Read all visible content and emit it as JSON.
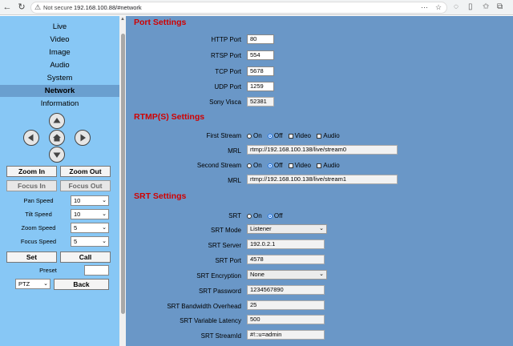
{
  "browser": {
    "security_label": "Not secure",
    "url": "192.168.100.88/#network"
  },
  "sidebar": {
    "menu": [
      "Live",
      "Video",
      "Image",
      "Audio",
      "System",
      "Network",
      "Information"
    ],
    "active_menu": "Network",
    "zoom_in": "Zoom In",
    "zoom_out": "Zoom Out",
    "focus_in": "Focus In",
    "focus_out": "Focus Out",
    "pan_speed_label": "Pan Speed",
    "pan_speed": "10",
    "tilt_speed_label": "Tilt Speed",
    "tilt_speed": "10",
    "zoom_speed_label": "Zoom Speed",
    "zoom_speed": "5",
    "focus_speed_label": "Focus Speed",
    "focus_speed": "5",
    "set": "Set",
    "call": "Call",
    "preset_label": "Preset",
    "preset_value": "",
    "mode": "PTZ",
    "back": "Back"
  },
  "port_settings": {
    "title": "Port Settings",
    "http_label": "HTTP Port",
    "http": "80",
    "rtsp_label": "RTSP Port",
    "rtsp": "554",
    "tcp_label": "TCP Port",
    "tcp": "5678",
    "udp_label": "UDP Port",
    "udp": "1259",
    "visca_label": "Sony Visca",
    "visca": "52381"
  },
  "rtmp": {
    "title": "RTMP(S) Settings",
    "first_label": "First Stream",
    "second_label": "Second Stream",
    "on": "On",
    "off": "Off",
    "video": "Video",
    "audio": "Audio",
    "mrl_label": "MRL",
    "mrl1": "rtmp://192.168.100.138/live/stream0",
    "mrl2": "rtmp://192.168.100.138/live/stream1"
  },
  "srt": {
    "title": "SRT Settings",
    "srt_label": "SRT",
    "on": "On",
    "off": "Off",
    "mode_label": "SRT Mode",
    "mode": "Listener",
    "server_label": "SRT Server",
    "server": "192.0.2.1",
    "port_label": "SRT Port",
    "port": "4578",
    "encryption_label": "SRT Encryption",
    "encryption": "None",
    "password_label": "SRT Password",
    "password": "1234567890",
    "overhead_label": "SRT Bandwidth Overhead",
    "overhead": "25",
    "latency_label": "SRT Variable Latency",
    "latency": "500",
    "streamid_label": "SRT StreamId",
    "streamid": "#!::u=admin"
  },
  "colors": {
    "sidebar_bg": "#87c7f5",
    "main_bg": "#6a97c7",
    "section_title": "#d00000",
    "active_menu_bg": "#6a9fcf"
  }
}
